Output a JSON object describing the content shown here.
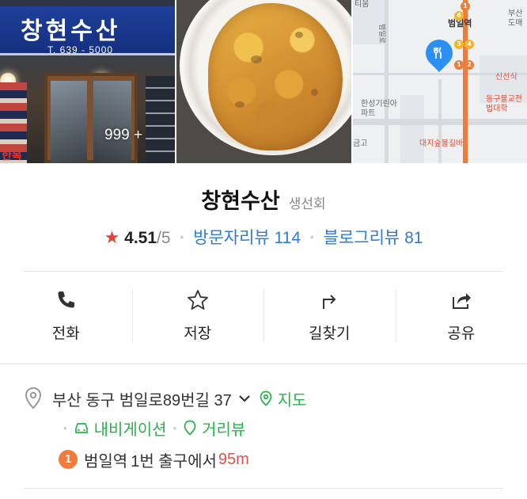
{
  "photos": {
    "sign_name": "창현수산",
    "sign_tel": "T. 639 - 5000",
    "shop_text": "한복",
    "more_count": "999 +"
  },
  "map": {
    "labels": [
      "티움",
      "범일역",
      "부산도매",
      "신선식",
      "한성기린아파트",
      "동구불교전법대학",
      "대지숲불길바",
      "금고",
      "범일로"
    ],
    "line_numbers": [
      "1",
      "6",
      "3",
      "4",
      "1",
      "2"
    ],
    "pin_icon": "restaurant-icon"
  },
  "place": {
    "name": "창현수산",
    "category": "생선회",
    "rating": "4.51",
    "rating_max": "/5",
    "visitor_reviews": "방문자리뷰 114",
    "blog_reviews": "블로그리뷰 81"
  },
  "actions": [
    {
      "label": "전화",
      "icon": "phone-icon"
    },
    {
      "label": "저장",
      "icon": "star-icon"
    },
    {
      "label": "길찾기",
      "icon": "directions-icon"
    },
    {
      "label": "공유",
      "icon": "share-icon"
    }
  ],
  "address": {
    "text": "부산 동구 범일로89번길 37",
    "map_link": "지도",
    "navigation_link": "내비게이션",
    "street_view_link": "거리뷰"
  },
  "subway": {
    "line": "1",
    "station": "범일역",
    "exit": "1번 출구에서",
    "distance": "95m"
  },
  "colors": {
    "accent_blue": "#2f7bd3",
    "link_green": "#2bb24c",
    "star_red": "#e8413a",
    "line1_orange": "#ef7c3a",
    "distance_red": "#e0524f"
  }
}
